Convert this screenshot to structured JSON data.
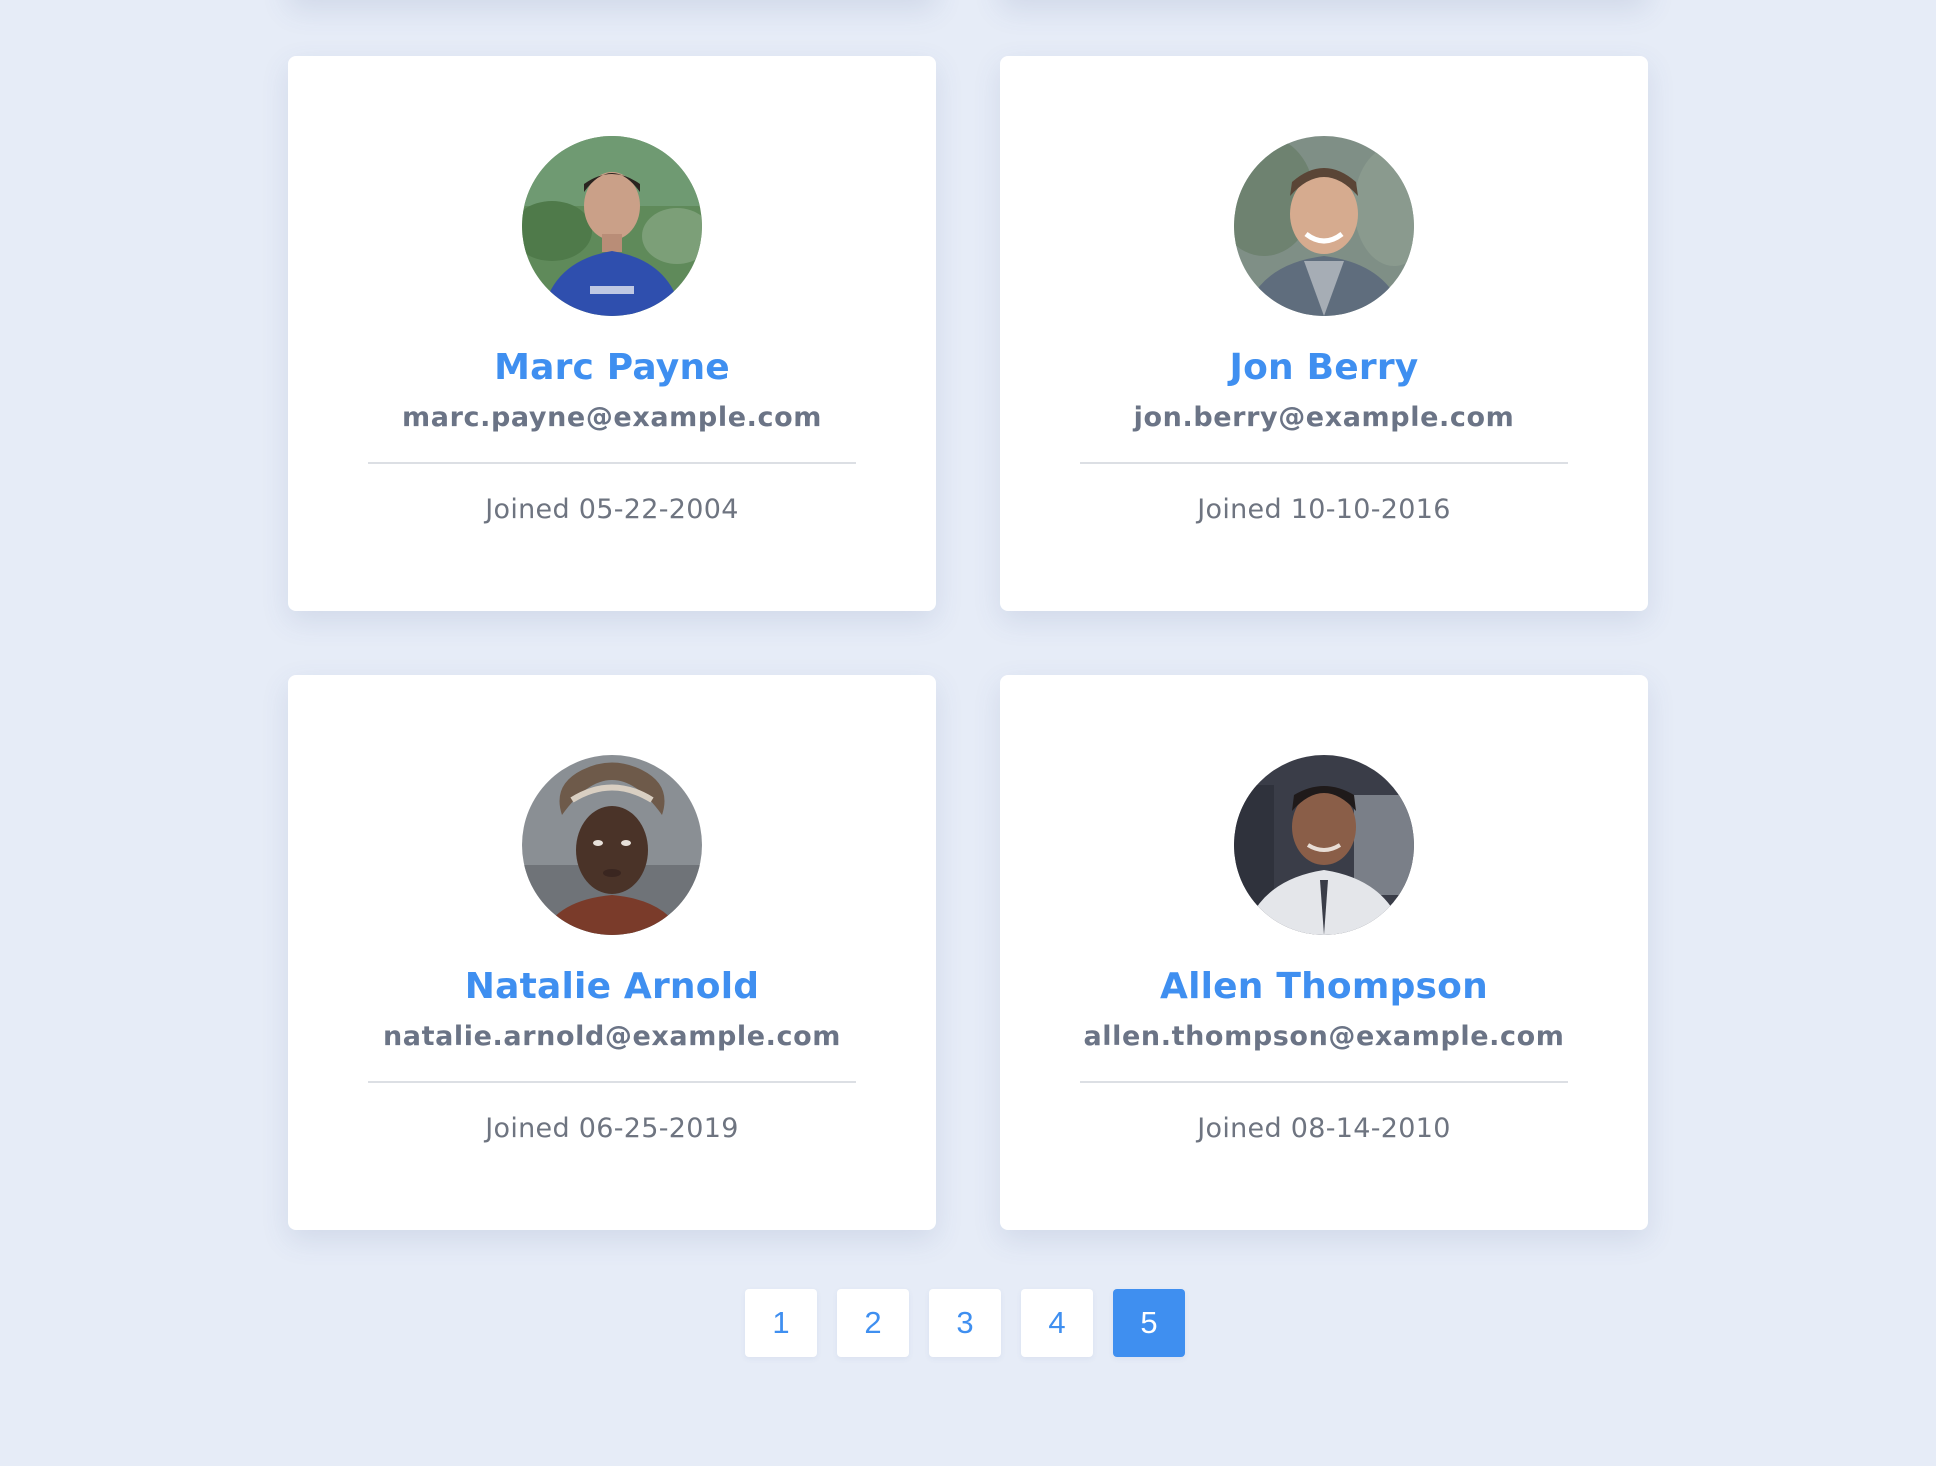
{
  "users": [
    {
      "name": "Marc Payne",
      "email": "marc.payne@example.com",
      "joined": "Joined 05-22-2004"
    },
    {
      "name": "Jon Berry",
      "email": "jon.berry@example.com",
      "joined": "Joined 10-10-2016"
    },
    {
      "name": "Natalie Arnold",
      "email": "natalie.arnold@example.com",
      "joined": "Joined 06-25-2019"
    },
    {
      "name": "Allen Thompson",
      "email": "allen.thompson@example.com",
      "joined": "Joined 08-14-2010"
    }
  ],
  "pagination": {
    "pages": [
      "1",
      "2",
      "3",
      "4",
      "5"
    ],
    "current": "5"
  },
  "colors": {
    "accent": "#3f8ff0",
    "background": "#e6ecf7",
    "card": "#ffffff",
    "muted_text": "#6b7486"
  }
}
